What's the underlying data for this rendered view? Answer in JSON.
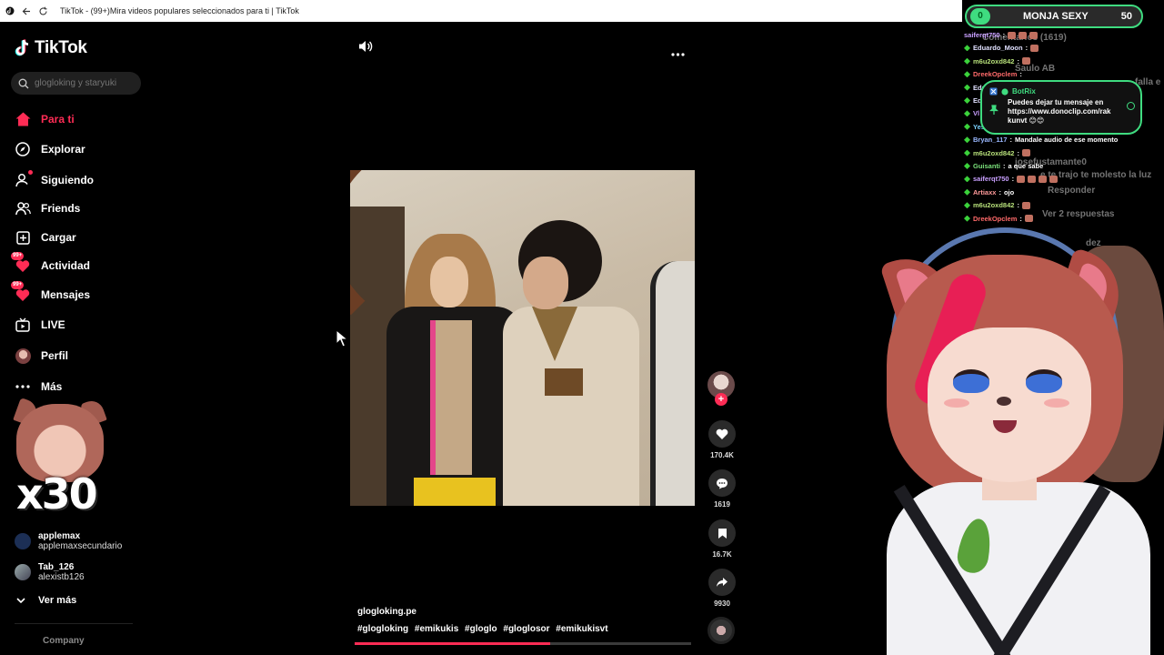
{
  "browser": {
    "title": "TikTok - (99+)Mira videos populares seleccionados para ti | TikTok"
  },
  "sidebar": {
    "logo": "TikTok",
    "search_placeholder": "glogloking y staryuki",
    "nav": [
      {
        "label": "Para ti",
        "icon": "home-icon",
        "active": true
      },
      {
        "label": "Explorar",
        "icon": "compass-icon"
      },
      {
        "label": "Siguiendo",
        "icon": "following-icon",
        "dot": true
      },
      {
        "label": "Friends",
        "icon": "friends-icon"
      },
      {
        "label": "Cargar",
        "icon": "upload-icon"
      },
      {
        "label": "Actividad",
        "icon": "activity-icon",
        "badge": "99+"
      },
      {
        "label": "Mensajes",
        "icon": "messages-icon",
        "badge": "99+"
      },
      {
        "label": "LIVE",
        "icon": "live-icon"
      },
      {
        "label": "Perfil",
        "icon": "profile-icon"
      },
      {
        "label": "Más",
        "icon": "more-icon"
      }
    ],
    "following": [
      {
        "name": "applemax",
        "handle": "applemaxsecundario"
      },
      {
        "name": "Tab_126",
        "handle": "alexistb126"
      }
    ],
    "see_more": "Ver más",
    "company": "Company"
  },
  "emote_overlay": {
    "multiplier": "x30"
  },
  "video": {
    "author": "glogloking.pe",
    "hashtags": [
      "#glogloking",
      "#emikukis",
      "#gloglo",
      "#gloglosor",
      "#emikukisvt"
    ],
    "progress": 0.58,
    "stats": {
      "likes": "170.4K",
      "comments": "1619",
      "saves": "16.7K",
      "shares": "9930"
    }
  },
  "stream": {
    "donation": {
      "amount": "0",
      "name": "MONJA SEXY",
      "value": "50"
    },
    "chat": [
      {
        "user": "saiferqt750",
        "color": "#c9a0ff",
        "text": "",
        "emotes": 3
      },
      {
        "user": "Eduardo_Moon",
        "color": "#e0e0ff",
        "text": "",
        "emotes": 1
      },
      {
        "user": "m6u2oxd842",
        "color": "#b7e07a",
        "text": "",
        "emotes": 1
      },
      {
        "user": "DreekOpclem",
        "color": "#ff6a6a",
        "text": "",
        "emotes": 0
      },
      {
        "user": "Edu",
        "color": "#e0e0ff",
        "text": "",
        "emotes": 0
      },
      {
        "user": "Ed",
        "color": "#e0e0ff",
        "text": "",
        "emotes": 0
      },
      {
        "user": "Vl",
        "color": "#c9a0ff",
        "text": "",
        "emotes": 0
      },
      {
        "user": "Yes",
        "color": "#7ad0ff",
        "text": "",
        "emotes": 0
      },
      {
        "user": "Bryan_117",
        "color": "#9ab8ff",
        "text": "Mandale audio de ese momento",
        "emotes": 0
      },
      {
        "user": "m6u2oxd842",
        "color": "#b7e07a",
        "text": "",
        "emotes": 1
      },
      {
        "user": "Guisanti",
        "color": "#7ae07a",
        "text": "a que sabe",
        "emotes": 0
      },
      {
        "user": "saiferqt750",
        "color": "#c9a0ff",
        "text": "",
        "emotes": 4
      },
      {
        "user": "Artiaxx",
        "color": "#ff9a9a",
        "text": "ojo",
        "emotes": 0
      },
      {
        "user": "m6u2oxd842",
        "color": "#b7e07a",
        "text": "",
        "emotes": 1
      },
      {
        "user": "DreekOpclem",
        "color": "#ff6a6a",
        "text": "",
        "emotes": 1
      }
    ],
    "ghost_text": {
      "comments_header": "Comentarios (1619)",
      "commenter": "Saulo AB",
      "reply_user": "josefustamante0",
      "reply_text": "e te trajo te molesto la luz",
      "responder": "Responder",
      "replies": "Ver 2 respuestas",
      "tail1": "falla e",
      "tail2": "dez"
    },
    "botrix": {
      "title": "BotRix",
      "message": "Puedes dejar tu mensaje en https://www.donoclip.com/rak kunvt 😊😊"
    }
  },
  "colors": {
    "accent": "#fe2c55",
    "overlay_green": "#3fdc80"
  }
}
